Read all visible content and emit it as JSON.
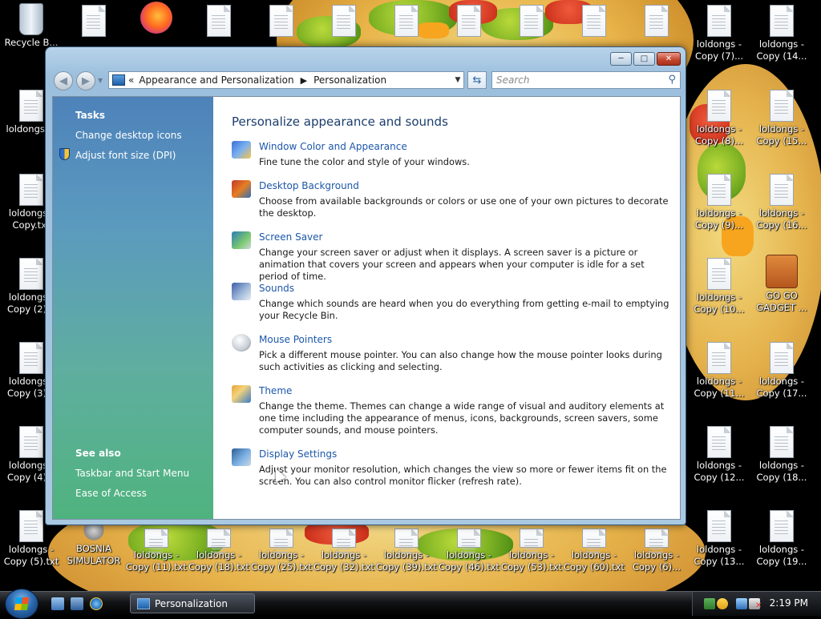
{
  "desktop": {
    "icons": [
      {
        "label": "Recycle B..."
      },
      {
        "label": ""
      },
      {
        "label": ""
      },
      {
        "label": ""
      },
      {
        "label": ""
      },
      {
        "label": ""
      },
      {
        "label": ""
      },
      {
        "label": ""
      },
      {
        "label": ""
      },
      {
        "label": ""
      },
      {
        "label": ""
      },
      {
        "label": "loldongs - Copy (7)..."
      },
      {
        "label": "loldongs - Copy (14..."
      },
      {
        "label": "loldongs...."
      },
      {
        "label": "loldongs - Copy (8)..."
      },
      {
        "label": "loldongs - Copy (15..."
      },
      {
        "label": "loldongs - Copy.txt"
      },
      {
        "label": "loldongs - Copy (9)..."
      },
      {
        "label": "loldongs - Copy (16..."
      },
      {
        "label": "loldongs - Copy (2)..."
      },
      {
        "label": "loldongs - Copy (10..."
      },
      {
        "label": "GO GO GADGET ..."
      },
      {
        "label": "loldongs - Copy (3)..."
      },
      {
        "label": "loldongs - Copy (11..."
      },
      {
        "label": "loldongs - Copy (17..."
      },
      {
        "label": "loldongs - Copy (4)..."
      },
      {
        "label": "loldongs - Copy (12..."
      },
      {
        "label": "loldongs - Copy (18..."
      },
      {
        "label": "loldongs - Copy (5).txt"
      },
      {
        "label": "BOSNIA SIMULATOR"
      },
      {
        "label": "loldongs - Copy (11).txt"
      },
      {
        "label": "loldongs - Copy (18).txt"
      },
      {
        "label": "loldongs - Copy (25).txt"
      },
      {
        "label": "loldongs - Copy (32).txt"
      },
      {
        "label": "loldongs - Copy (39).txt"
      },
      {
        "label": "loldongs - Copy (46).txt"
      },
      {
        "label": "loldongs - Copy (53).txt"
      },
      {
        "label": "loldongs - Copy (60).txt"
      },
      {
        "label": "loldongs - Copy (6)..."
      },
      {
        "label": "loldongs - Copy (13..."
      },
      {
        "label": "loldongs - Copy (19..."
      }
    ]
  },
  "window": {
    "address": {
      "chevron": "«",
      "crumbs": [
        "Appearance and Personalization",
        "Personalization"
      ]
    },
    "search_placeholder": "Search",
    "sidebar": {
      "tasks_heading": "Tasks",
      "tasks": [
        "Change desktop icons",
        "Adjust font size (DPI)"
      ],
      "see_also_heading": "See also",
      "see_also": [
        "Taskbar and Start Menu",
        "Ease of Access"
      ]
    },
    "main": {
      "title": "Personalize appearance and sounds",
      "items": [
        {
          "link": "Window Color and Appearance",
          "desc": "Fine tune the color and style of your windows.",
          "icon": "window-color-icon"
        },
        {
          "link": "Desktop Background",
          "desc": "Choose from available backgrounds or colors or use one of your own pictures to decorate the desktop.",
          "icon": "desktop-background-icon"
        },
        {
          "link": "Screen Saver",
          "desc": "Change your screen saver or adjust when it displays. A screen saver is a picture or animation that covers your screen and appears when your computer is idle for a set period of time.",
          "icon": "screen-saver-icon"
        },
        {
          "link": "Sounds",
          "desc": "Change which sounds are heard when you do everything from getting e-mail to emptying your Recycle Bin.",
          "icon": "sounds-icon"
        },
        {
          "link": "Mouse Pointers",
          "desc": "Pick a different mouse pointer. You can also change how the mouse pointer looks during such activities as clicking and selecting.",
          "icon": "mouse-pointer-icon"
        },
        {
          "link": "Theme",
          "desc": "Change the theme. Themes can change a wide range of visual and auditory elements at one time including the appearance of menus, icons, backgrounds, screen savers, some computer sounds, and mouse pointers.",
          "icon": "theme-icon"
        },
        {
          "link": "Display Settings",
          "desc": "Adjust your monitor resolution, which changes the view so more or fewer items fit on the screen. You can also control monitor flicker (refresh rate).",
          "icon": "display-settings-icon"
        }
      ]
    }
  },
  "taskbar": {
    "task_button": "Personalization",
    "clock": "2:19 PM"
  }
}
